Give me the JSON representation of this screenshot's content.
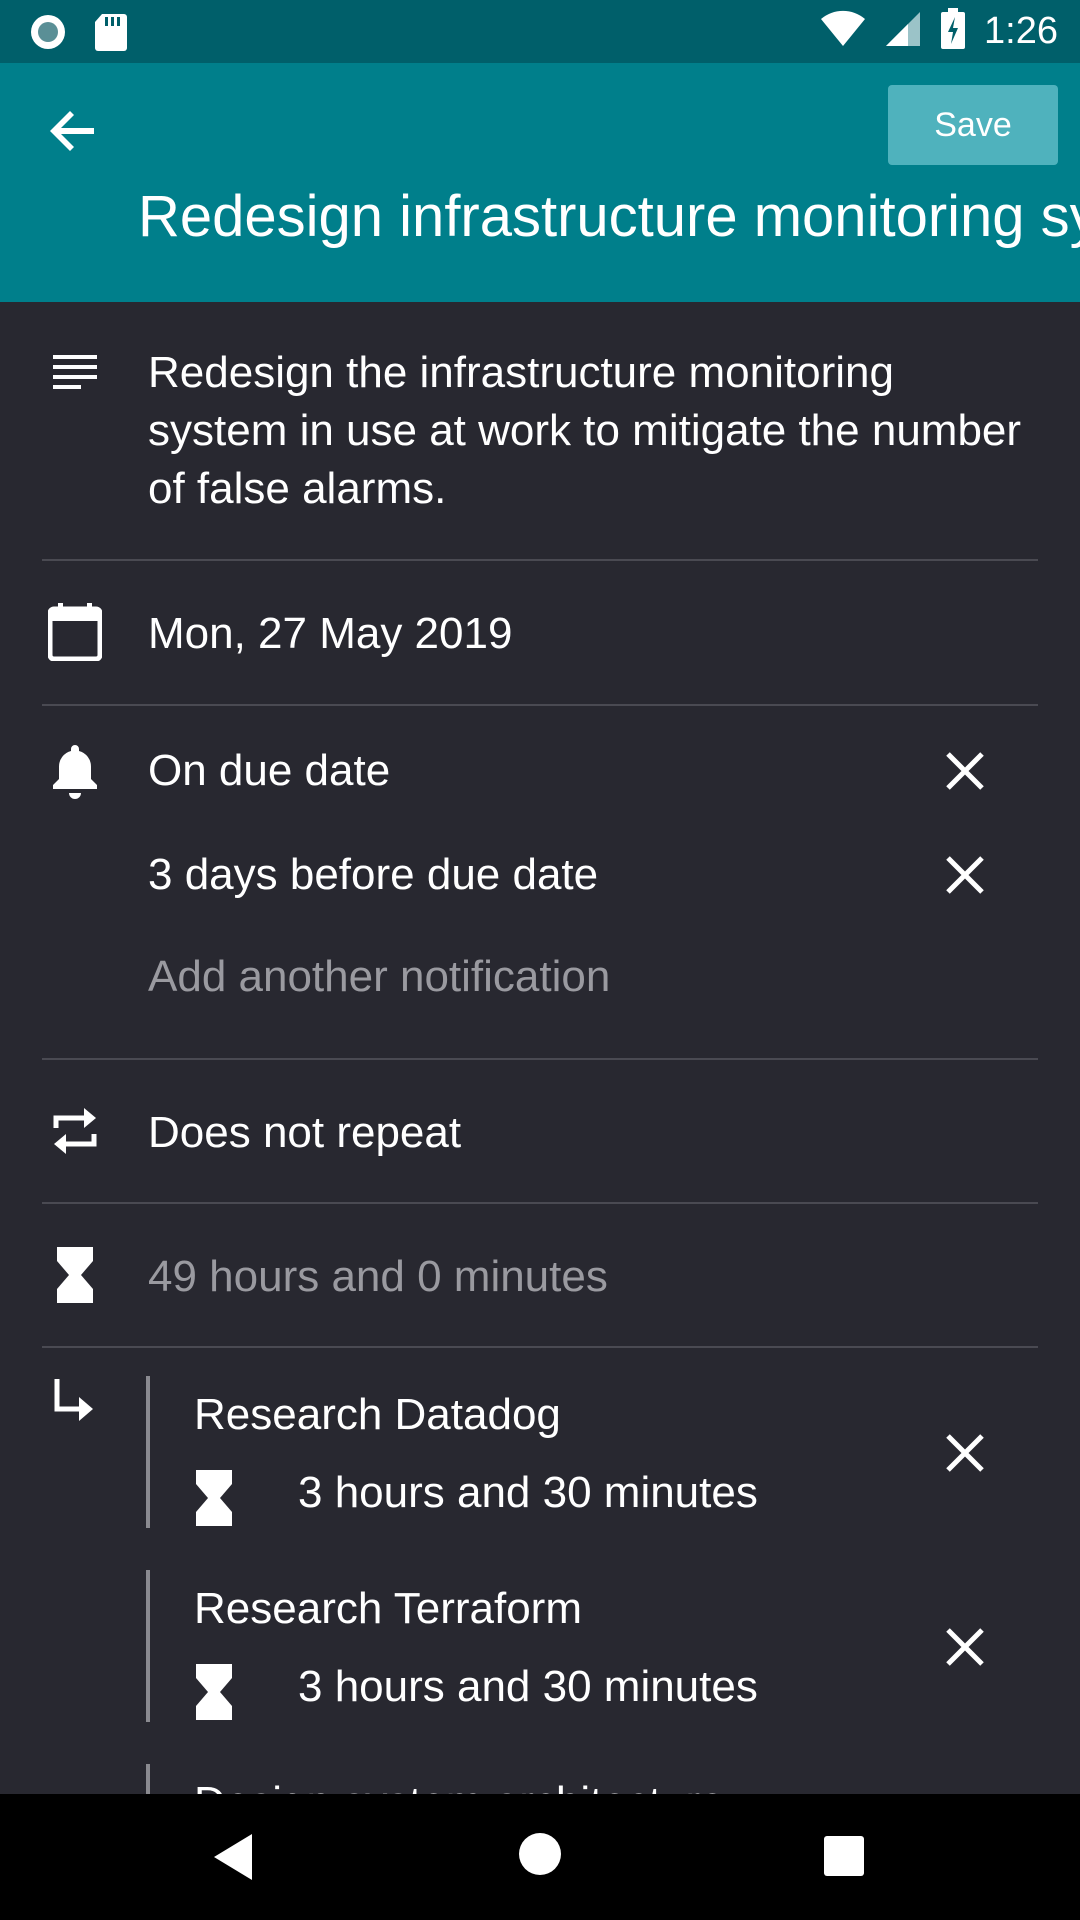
{
  "status_bar": {
    "time": "1:26",
    "left_icons": [
      "record-icon",
      "sd-card-icon"
    ],
    "right_icons": [
      "wifi-icon",
      "signal-icon",
      "battery-charging-icon"
    ]
  },
  "toolbar": {
    "save_label": "Save",
    "title": "Redesign infrastructure monitoring sy",
    "back_icon": "arrow-left-icon",
    "background": "#007f8b",
    "save_color": "#4fb2bd"
  },
  "description": {
    "text": "Redesign the infrastructure monitoring system in use at work to mitigate the number of false alarms.",
    "lines": [
      "Redesign the infrastructure monitoring",
      "system in use at work to mitigate the number",
      "of false alarms."
    ]
  },
  "due_date": {
    "value": "Mon, 27 May 2019"
  },
  "notifications": {
    "items": [
      {
        "label": "On due date"
      },
      {
        "label": "3 days before due date"
      }
    ],
    "add_label": "Add another notification"
  },
  "repeat": {
    "value": "Does not repeat"
  },
  "duration": {
    "value": "49 hours and 0 minutes"
  },
  "subtasks": [
    {
      "title": "Research Datadog",
      "duration": "3 hours and 30 minutes"
    },
    {
      "title": "Research Terraform",
      "duration": "3 hours and 30 minutes"
    },
    {
      "title": "Design system architecture",
      "duration": ""
    }
  ],
  "colors": {
    "background": "#282830",
    "status_bar": "#005f6a",
    "divider": "#4a4a52",
    "muted_text": "#9a9aa0"
  }
}
